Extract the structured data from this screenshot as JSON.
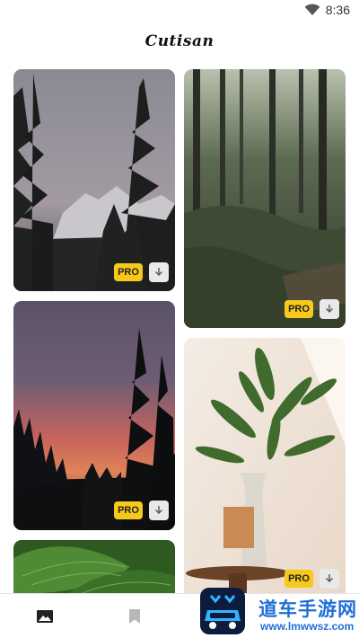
{
  "status_bar": {
    "time": "8:36",
    "wifi_icon": "wifi-icon"
  },
  "app": {
    "title": "Cutisan"
  },
  "feed": {
    "cards": [
      {
        "scene": "dusk-pines-mountain",
        "badge": "PRO",
        "download_icon": "download-icon"
      },
      {
        "scene": "forest-trail",
        "badge": "PRO",
        "download_icon": "download-icon"
      },
      {
        "scene": "sunset-tree-silhouette",
        "badge": "PRO",
        "download_icon": "download-icon"
      },
      {
        "scene": "plant-in-bottle",
        "badge": "PRO",
        "download_icon": "download-icon"
      },
      {
        "scene": "green-leaves"
      }
    ]
  },
  "bottom_nav": {
    "items": [
      {
        "icon": "image-icon",
        "active": true
      },
      {
        "icon": "bookmark-icon",
        "active": false
      }
    ]
  },
  "watermark": {
    "title": "道车手游网",
    "url": "www.lmwwsz.com"
  },
  "colors": {
    "pro_badge": "#f7c91a",
    "watermark": "#1f6fd6",
    "nav_active": "#222222",
    "nav_inactive": "#b8b8b8"
  }
}
